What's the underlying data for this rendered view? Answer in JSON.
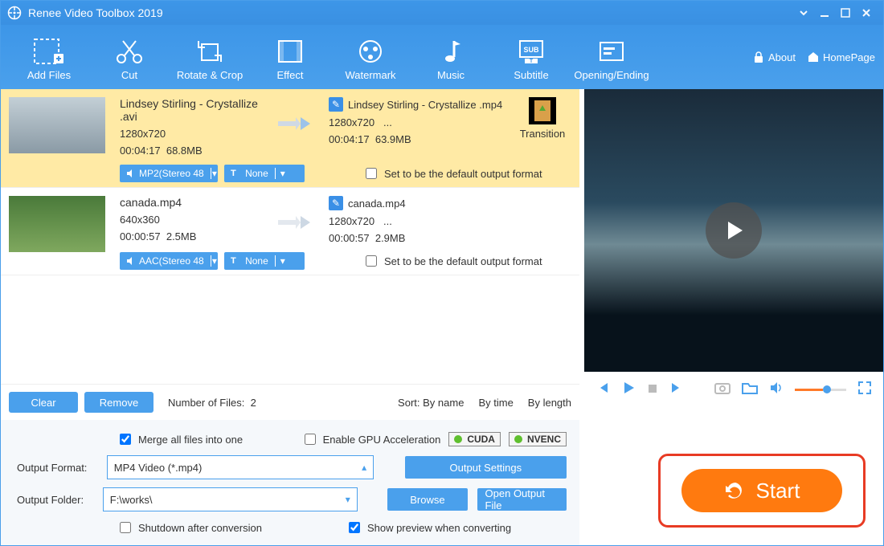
{
  "title": "Renee Video Toolbox 2019",
  "toolbar": [
    {
      "label": "Add Files"
    },
    {
      "label": "Cut"
    },
    {
      "label": "Rotate & Crop"
    },
    {
      "label": "Effect"
    },
    {
      "label": "Watermark"
    },
    {
      "label": "Music"
    },
    {
      "label": "Subtitle"
    },
    {
      "label": "Opening/Ending"
    }
  ],
  "links": {
    "about": "About",
    "home": "HomePage"
  },
  "files": [
    {
      "name": "Lindsey Stirling - Crystallize .avi",
      "res": "1280x720",
      "dur": "00:04:17",
      "size": "68.8MB",
      "audio": "MP2(Stereo 48",
      "sub": "None",
      "outname": "Lindsey Stirling - Crystallize .mp4",
      "outres": "1280x720",
      "outmore": "...",
      "outdur": "00:04:17",
      "outsize": "63.9MB",
      "trans": "Transition",
      "defcheck": "Set to be the default output format"
    },
    {
      "name": "canada.mp4",
      "res": "640x360",
      "dur": "00:00:57",
      "size": "2.5MB",
      "audio": "AAC(Stereo 48",
      "sub": "None",
      "outname": "canada.mp4",
      "outres": "1280x720",
      "outmore": "...",
      "outdur": "00:00:57",
      "outsize": "2.9MB",
      "defcheck": "Set to be the default output format"
    }
  ],
  "actions": {
    "clear": "Clear",
    "remove": "Remove",
    "count_label": "Number of Files:",
    "count": "2"
  },
  "sort": {
    "label": "Sort:",
    "byname": "By name",
    "bytime": "By time",
    "bylength": "By length"
  },
  "settings": {
    "merge": "Merge all files into one",
    "gpu": "Enable GPU Acceleration",
    "cuda": "CUDA",
    "nvenc": "NVENC",
    "format_label": "Output Format:",
    "format_value": "MP4 Video (*.mp4)",
    "outset": "Output Settings",
    "folder_label": "Output Folder:",
    "folder_value": "F:\\works\\",
    "browse": "Browse",
    "openfolder": "Open Output File",
    "shutdown": "Shutdown after conversion",
    "preview": "Show preview when converting"
  },
  "start": "Start"
}
